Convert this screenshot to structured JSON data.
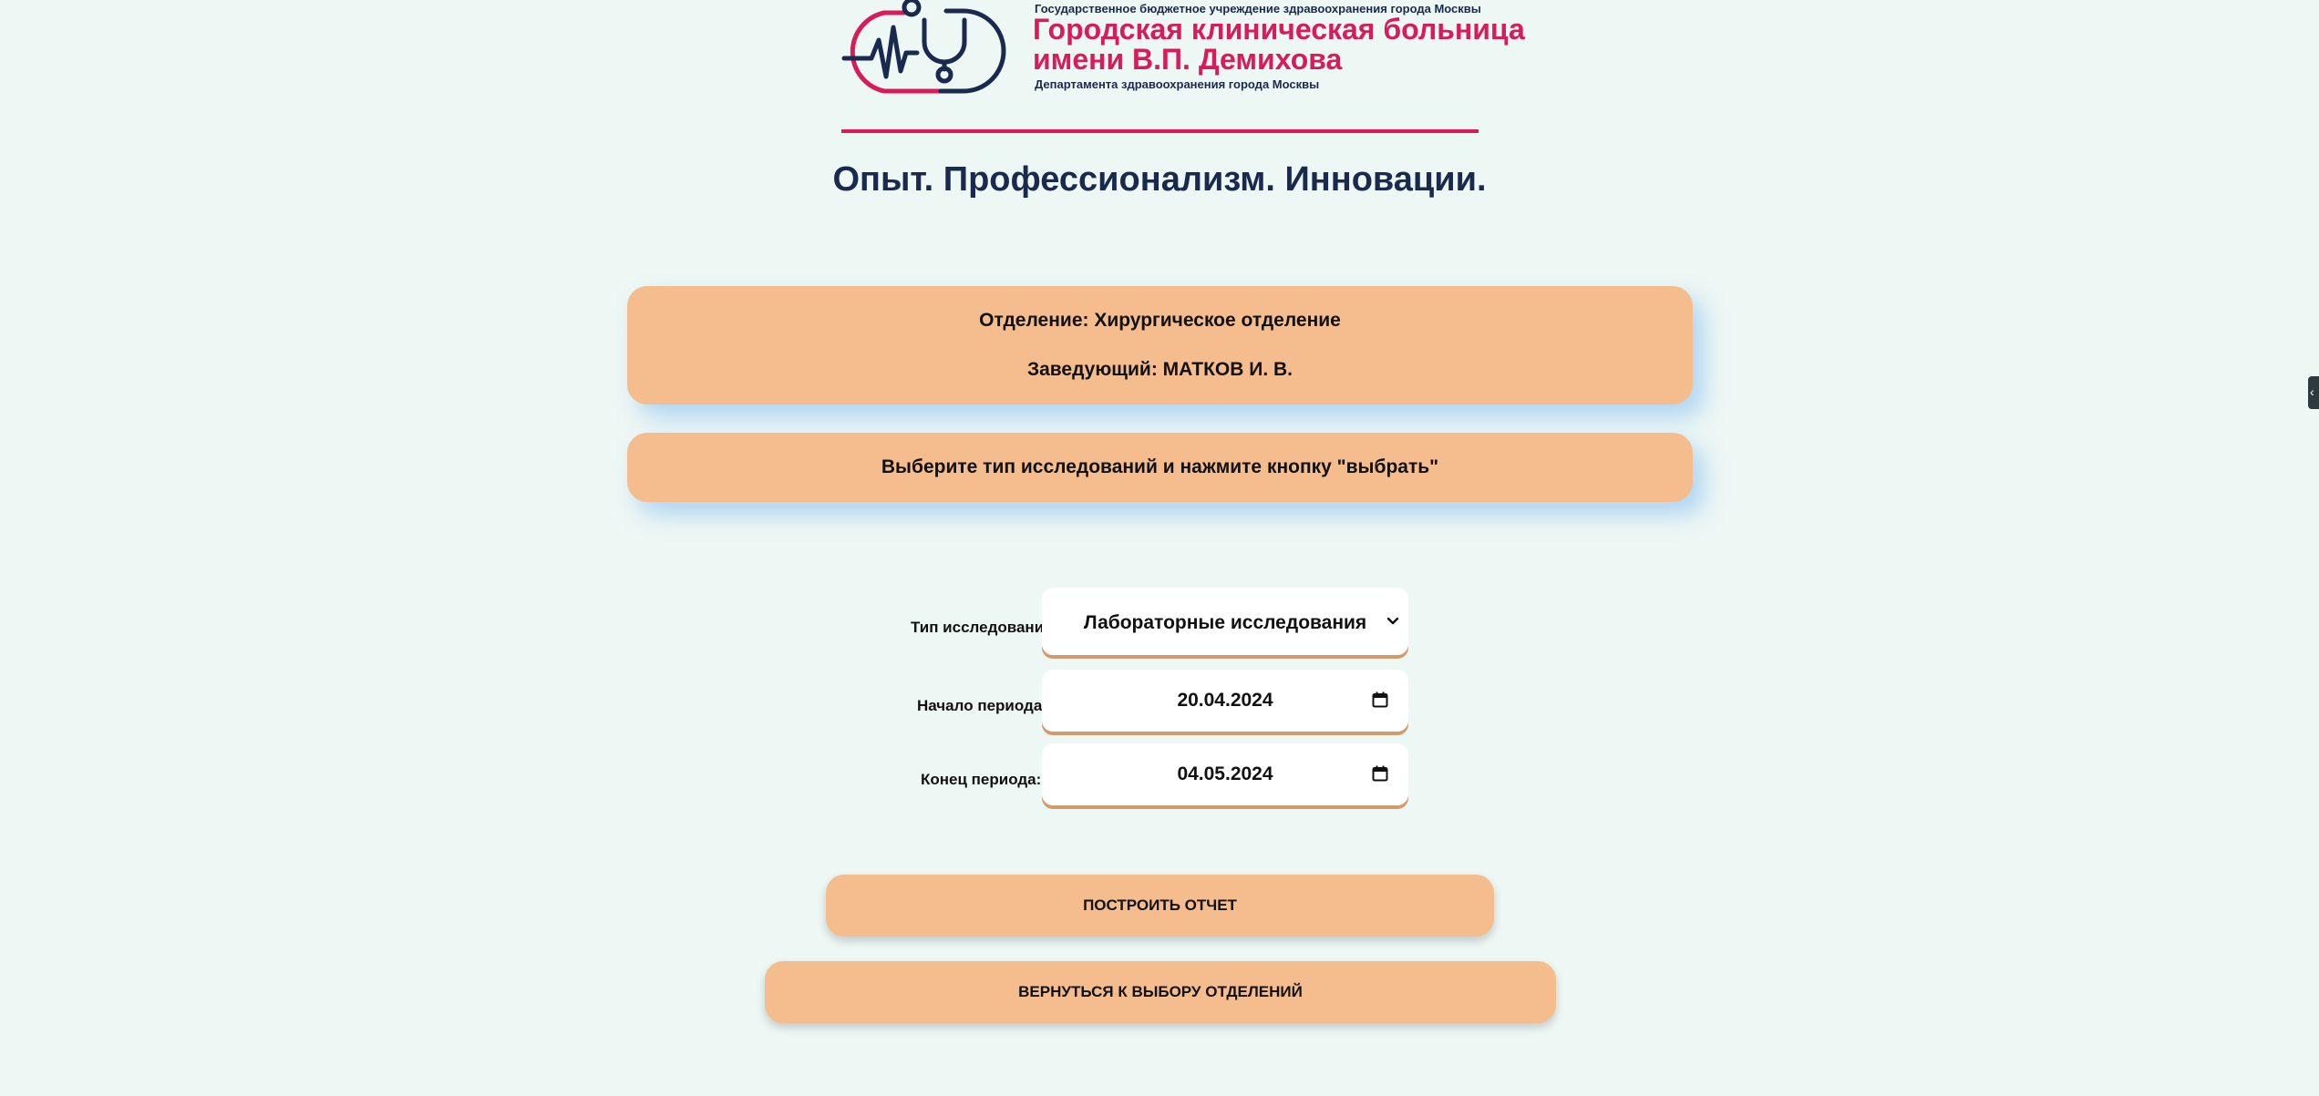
{
  "header": {
    "org_top": "Государственное бюджетное учреждение здравоохранения города Москвы",
    "hospital_name_line1": "Городская клиническая больница",
    "hospital_name_line2": "имени В.П. Демихова",
    "org_bottom": "Департамента здравоохранения города Москвы",
    "slogan": "Опыт. Профессионализм. Инновации.",
    "logo_icon": "stethoscope-heartbeat-logo",
    "brand_pink": "#d81b5a",
    "brand_navy": "#1a2a4e"
  },
  "department": {
    "line": "Отделение: Хирургическое отделение",
    "head": "Заведующий: МАТКОВ И. В."
  },
  "hint": "Выберите тип исследований и нажмите кнопку \"выбрать\"",
  "form": {
    "type_label": "Тип исследования:",
    "type_value": "Лабораторные исследования",
    "start_label": "Начало периода:",
    "start_value": "20.04.2024",
    "end_label": "Конец периода:",
    "end_value": "04.05.2024"
  },
  "buttons": {
    "build_report": "ПОСТРОИТЬ ОТЧЕТ",
    "back": "ВЕРНУТЬСЯ К ВЫБОРУ ОТДЕЛЕНИЙ"
  },
  "side_tab": {
    "glyph": "‹"
  },
  "colors": {
    "background": "#edf7f4",
    "card": "#f5bd8e",
    "field_underline": "#d39a6e"
  }
}
